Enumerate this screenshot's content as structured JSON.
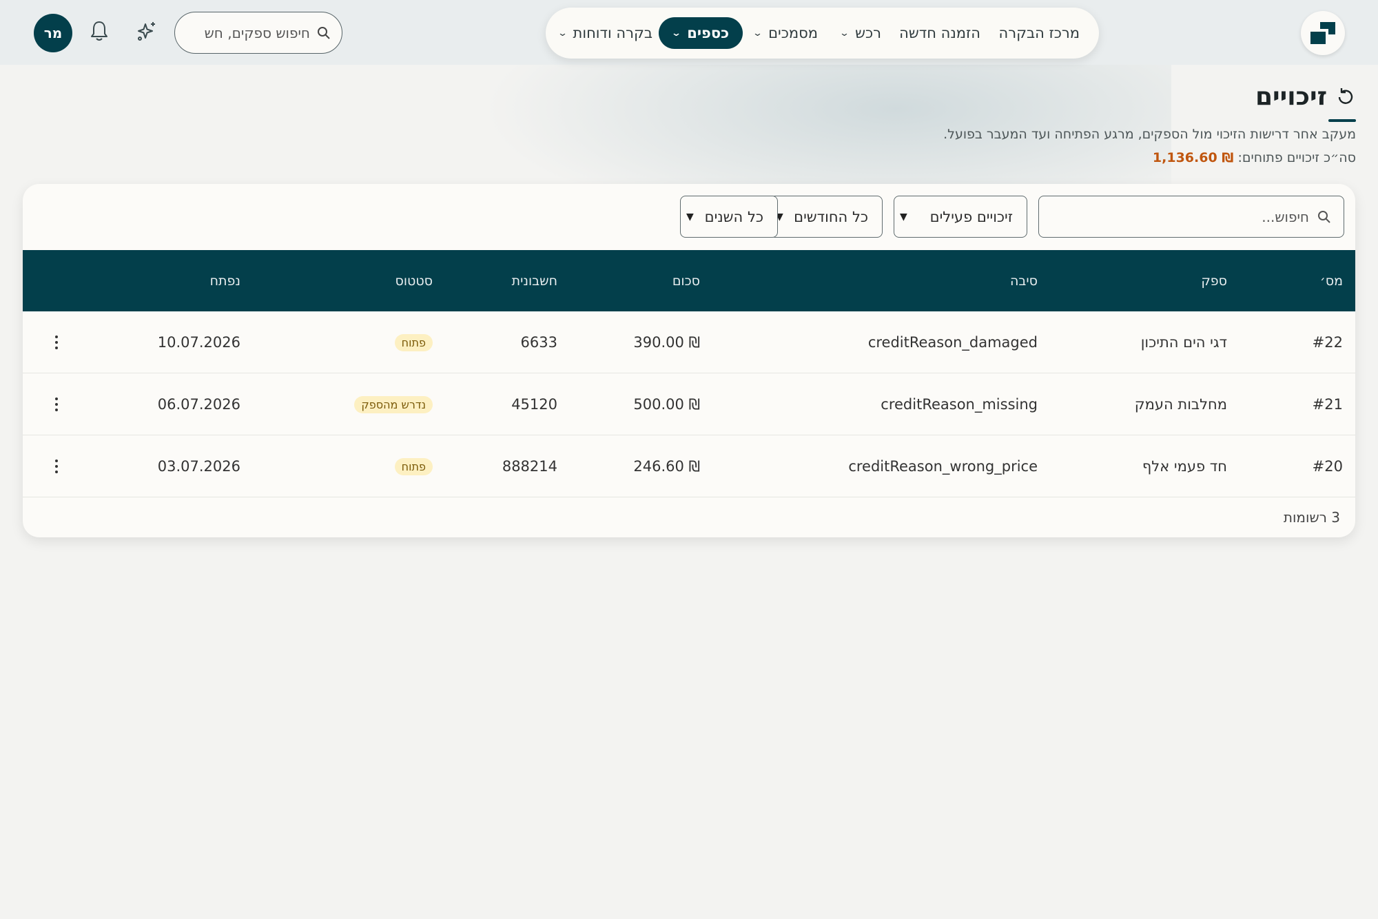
{
  "header": {
    "nav": [
      {
        "label": "מרכז הבקרה",
        "has_chevron": false,
        "active": false
      },
      {
        "label": "הזמנה חדשה",
        "has_chevron": false,
        "active": false
      },
      {
        "label": "רכש",
        "has_chevron": true,
        "active": false
      },
      {
        "label": "מסמכים",
        "has_chevron": true,
        "active": false
      },
      {
        "label": "כספים",
        "has_chevron": true,
        "active": true
      },
      {
        "label": "בקרה ודוחות",
        "has_chevron": true,
        "active": false
      }
    ],
    "search_placeholder": "חיפוש ספקים, חש",
    "avatar_initials": "מר",
    "colors": {
      "primary": "#033f4b",
      "topbar_bg": "#e9edee"
    }
  },
  "page": {
    "title": "זיכויים",
    "subtitle": "מעקב אחר דרישות הזיכוי מול הספקים, מרגע הפתיחה ועד המעבר בפועל.",
    "total_label": "סה״כ זיכויים פתוחים:",
    "total_value": "₪ 1,136.60",
    "total_color": "#c0560f"
  },
  "filters": {
    "search_placeholder": "חיפוש...",
    "status_select": "זיכויים פעילים",
    "month_select": "כל החודשים",
    "year_select": "כל השנים"
  },
  "table": {
    "columns": [
      "מס׳",
      "ספק",
      "סיבה",
      "סכום",
      "חשבונית",
      "סטטוס",
      "נפתח"
    ],
    "rows": [
      {
        "id": "#22",
        "supplier": "דגי הים התיכון",
        "reason": "creditReason_damaged",
        "amount": "390.00 ₪",
        "invoice": "6633",
        "status": "פתוח",
        "opened": "10.07.2026"
      },
      {
        "id": "#21",
        "supplier": "מחלבות העמק",
        "reason": "creditReason_missing",
        "amount": "500.00 ₪",
        "invoice": "45120",
        "status": "נדרש מהספק",
        "opened": "06.07.2026"
      },
      {
        "id": "#20",
        "supplier": "חד פעמי אלף",
        "reason": "creditReason_wrong_price",
        "amount": "246.60 ₪",
        "invoice": "888214",
        "status": "פתוח",
        "opened": "03.07.2026"
      }
    ],
    "footer_count": "3 רשומות"
  }
}
